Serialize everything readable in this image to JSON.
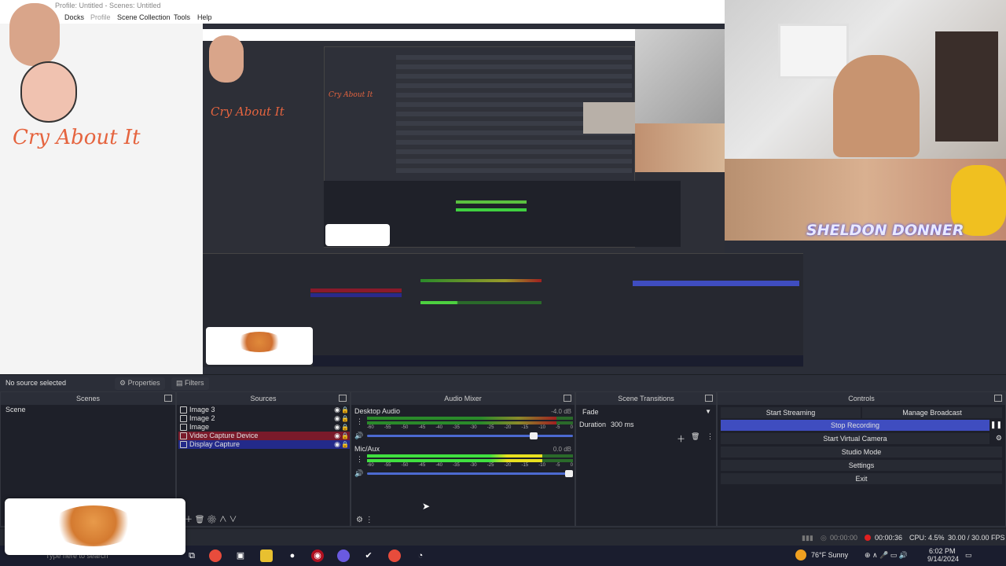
{
  "window": {
    "title": "Profile: Untitled - Scenes: Untitled"
  },
  "menu": {
    "items": [
      "Docks",
      "Profile",
      "Scene Collection",
      "Tools",
      "Help"
    ]
  },
  "overlay": {
    "caption": "Cry About It",
    "cam_name": "SHELDON DONNER"
  },
  "source_toolbar": {
    "no_source": "No source selected",
    "properties": "Properties",
    "filters": "Filters"
  },
  "scenes": {
    "title": "Scenes",
    "items": [
      "Scene"
    ]
  },
  "sources": {
    "title": "Sources",
    "items": [
      {
        "name": "Image 3",
        "state": "normal"
      },
      {
        "name": "Image 2",
        "state": "normal"
      },
      {
        "name": "Image",
        "state": "normal"
      },
      {
        "name": "Video Capture Device",
        "state": "red"
      },
      {
        "name": "Display Capture",
        "state": "blue"
      }
    ]
  },
  "mixer": {
    "title": "Audio Mixer",
    "channels": [
      {
        "name": "Desktop Audio",
        "db": "-4.0 dB",
        "level": 0.92,
        "fader": 0.82
      },
      {
        "name": "Mic/Aux",
        "db": "0.0 dB",
        "level": 0.85,
        "fader": 1.0
      }
    ],
    "scale": [
      "-60",
      "-55",
      "-50",
      "-45",
      "-40",
      "-35",
      "-30",
      "-25",
      "-20",
      "-15",
      "-10",
      "-5",
      "0"
    ]
  },
  "transitions": {
    "title": "Scene Transitions",
    "type": "Fade",
    "duration_label": "Duration",
    "duration": "300 ms"
  },
  "controls": {
    "title": "Controls",
    "start_streaming": "Start Streaming",
    "manage_broadcast": "Manage Broadcast",
    "stop_recording": "Stop Recording",
    "virtual_camera": "Start Virtual Camera",
    "studio_mode": "Studio Mode",
    "settings": "Settings",
    "exit": "Exit"
  },
  "status": {
    "stream_time": "00:00:00",
    "rec_time": "00:00:36",
    "cpu": "CPU: 4.5%",
    "fps": "30.00 / 30.00 FPS"
  },
  "taskbar": {
    "search_placeholder": "Type here to search",
    "weather": "76°F  Sunny",
    "time": "6:02 PM",
    "date": "9/14/2024"
  },
  "colors": {
    "accent": "#3f4dc0",
    "record": "#e02020",
    "caption": "#e5643f"
  }
}
